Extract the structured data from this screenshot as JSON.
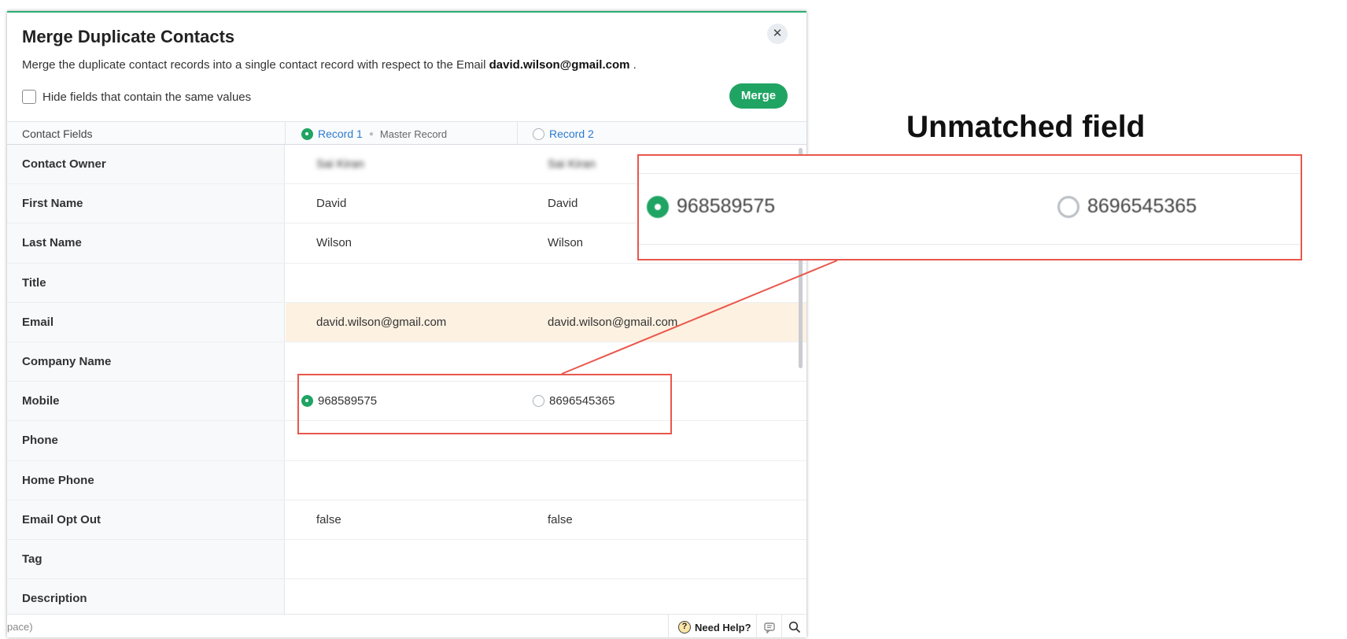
{
  "dialog": {
    "title": "Merge Duplicate Contacts",
    "close_icon": "close-icon",
    "description_prefix": "Merge the duplicate contact records into a single contact record with respect to the Email ",
    "description_email": "david.wilson@gmail.com",
    "description_suffix": " .",
    "hide_fields_label": "Hide fields that contain the same values",
    "hide_fields_checked": false,
    "merge_label": "Merge",
    "accent_color": "#1fa463"
  },
  "table": {
    "header": {
      "fields_label": "Contact Fields",
      "record1_label": "Record 1",
      "record1_selected": true,
      "master_label": "Master Record",
      "record2_label": "Record 2",
      "record2_selected": false
    },
    "rows": [
      {
        "label": "Contact Owner",
        "v1": "Sai Kiran",
        "v2": "Sai Kiran",
        "blurred": true
      },
      {
        "label": "First Name",
        "v1": "David",
        "v2": "David"
      },
      {
        "label": "Last Name",
        "v1": "Wilson",
        "v2": "Wilson"
      },
      {
        "label": "Title",
        "v1": "",
        "v2": ""
      },
      {
        "label": "Email",
        "v1": "david.wilson@gmail.com",
        "v2": "david.wilson@gmail.com",
        "highlight": true
      },
      {
        "label": "Company Name",
        "v1": "",
        "v2": ""
      },
      {
        "label": "Mobile",
        "v1": "968589575",
        "v2": "8696545365",
        "radios": true
      },
      {
        "label": "Phone",
        "v1": "",
        "v2": ""
      },
      {
        "label": "Home Phone",
        "v1": "",
        "v2": ""
      },
      {
        "label": "Email Opt Out",
        "v1": "false",
        "v2": "false"
      },
      {
        "label": "Tag",
        "v1": "",
        "v2": ""
      },
      {
        "label": "Description",
        "v1": "",
        "v2": ""
      }
    ]
  },
  "footer": {
    "workspace_text": "pace)",
    "help_label": "Need Help?",
    "help_icon": "question-icon",
    "feedback_icon": "feedback-icon",
    "search_icon": "search-icon"
  },
  "annotation": {
    "title": "Unmatched field",
    "value1": "968589575",
    "value2": "8696545365",
    "color": "#e9574c"
  }
}
